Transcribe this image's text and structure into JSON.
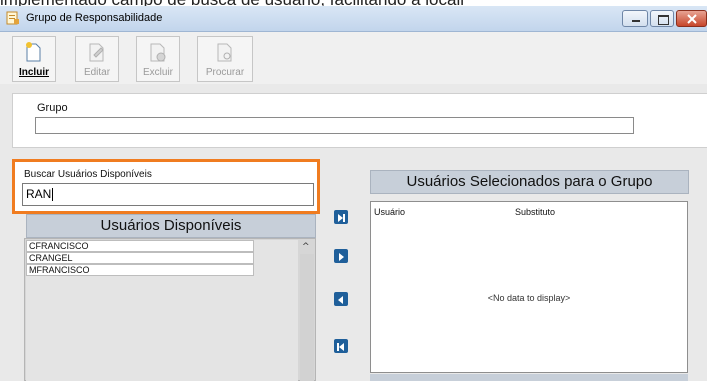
{
  "caption": "implementado campo de busca de usuário, facilitando a locali",
  "window": {
    "title": "Grupo de Responsabilidade"
  },
  "toolbar": {
    "buttons": [
      {
        "label": "Incluir",
        "enabled": true
      },
      {
        "label": "Editar",
        "enabled": false
      },
      {
        "label": "Excluir",
        "enabled": false
      },
      {
        "label": "Procurar",
        "enabled": false
      }
    ]
  },
  "group": {
    "label": "Grupo",
    "value": ""
  },
  "search": {
    "label": "Buscar Usuários Disponíveis",
    "value": "RAN"
  },
  "available": {
    "header": "Usuários Disponíveis",
    "items": [
      "CFRANCISCO",
      "CRANGEL",
      "MFRANCISCO"
    ]
  },
  "selected": {
    "header": "Usuários Selecionados para o Grupo",
    "columns": [
      "Usuário",
      "Substituto"
    ],
    "empty_text": "<No data to display>"
  },
  "icons": {
    "move_all_right": "skip-next-icon",
    "move_right": "play-right-icon",
    "move_left": "play-left-icon",
    "move_all_left": "skip-previous-icon"
  },
  "colors": {
    "highlight": "#f07c20",
    "arrow_button": "#1f5f9a",
    "panel_header": "#c7cfd9"
  }
}
